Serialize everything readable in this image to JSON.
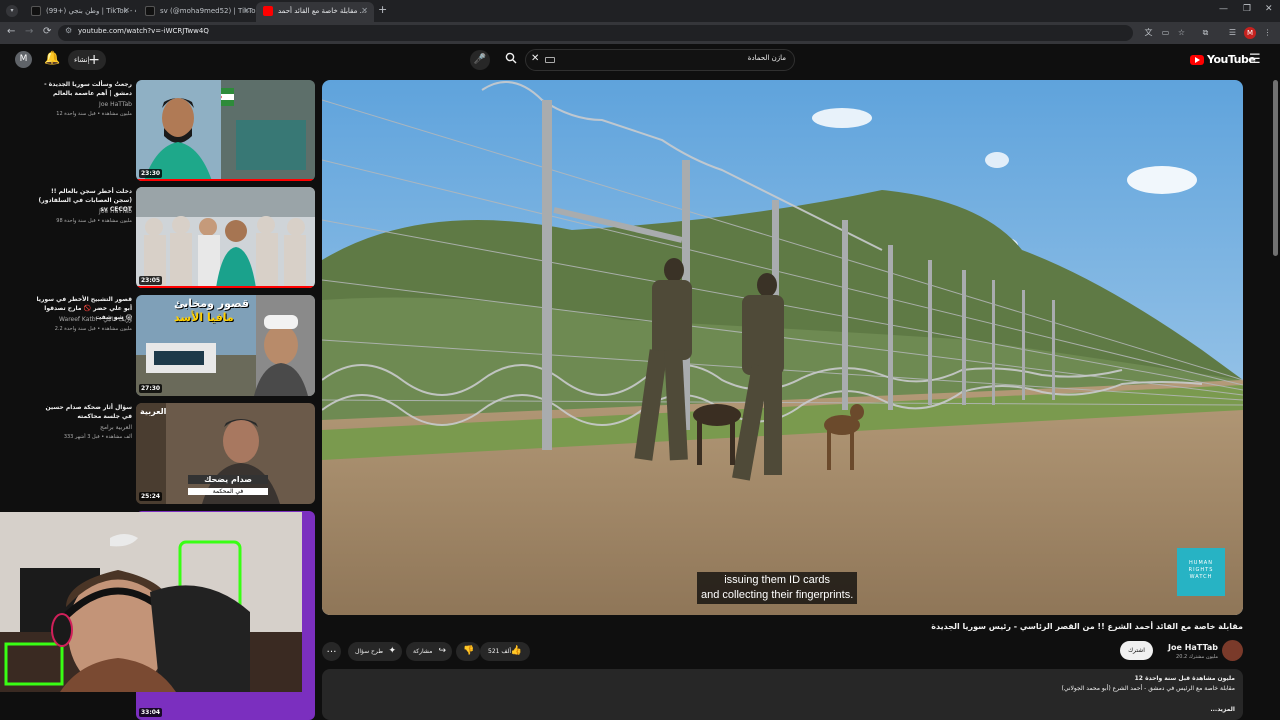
{
  "browser": {
    "tabs": [
      {
        "label": "(99+) وطن بنجي | TikTok - 476",
        "favicon_color": "#111111"
      },
      {
        "label": "sv (@moha9med52) | TikTok",
        "favicon_color": "#111111"
      },
      {
        "label": "مقابلة خاصة مع القائد أحمد ...",
        "favicon_color": "#ff0000"
      }
    ],
    "new_tab": "+",
    "tab_menu": "▾",
    "url": "youtube.com/watch?v=-iWCRJTww4Q",
    "profile_initial": "M",
    "window_controls": [
      "—",
      "❐",
      "✕"
    ]
  },
  "youtube": {
    "header": {
      "user_initial": "M",
      "create_label": "إنشاء",
      "search_value": "مازن الحمادة",
      "logo_text": "YouTube"
    },
    "recommendations": [
      {
        "title": "رجعتُ وسألت سوريا الجديدة - دمشق | أهم عاصمة بالعالم",
        "channel": "Joe HaTTab",
        "meta": "12 مليون مشاهدة • قبل سنة واحدة",
        "duration": "23:30",
        "progress": 1.0
      },
      {
        "title": "دخلت أخطر سجن بالعالم !! (سجن العصابات في السلفادور) sv CECOT",
        "channel": "Joe HaTTab",
        "meta": "98 مليون مشاهدة • قبل سنة واحدة",
        "duration": "23:05",
        "progress": 1.0
      },
      {
        "title": "قصور التشبيح الأخطر في سوريا أبو علي خضر 🚫 مارح تصدقوا شو شفت 😱",
        "channel": "Wareef Katbi - وريف كاتبي",
        "meta": "2.2 مليون مشاهدة • قبل سنة واحدة",
        "duration": "27:30",
        "progress": 0
      },
      {
        "title": "سؤال أثار ضحكة صدام حسين في جلسة محاكمته",
        "channel": "العربية برامج",
        "meta": "333 ألف مشاهدة • قبل 3 أشهر",
        "duration": "25:24",
        "progress": 0
      },
      {
        "title": "",
        "channel": "",
        "meta": "",
        "duration": "33:04",
        "progress": 0
      }
    ],
    "thumb_texts": {
      "t3_title": "قصور ومخابئ",
      "t3_sub": "مافيا الأسد",
      "t4_logo": "العربية",
      "t4_cap1": "صدام يضحك",
      "t4_cap2": "في المحكمة"
    },
    "video": {
      "caption_line1": "issuing them ID cards",
      "caption_line2": "and collecting their fingerprints.",
      "watermark": "HUMAN RIGHTS WATCH",
      "title": "مقابلة خاصة مع القائد أحمد الشرع !! من القصر الرئاسي - رئيس سوريا الجديدة",
      "channel": "Joe HaTTab",
      "subscribers": "20.2 مليون مشترك",
      "subscribe_label": "اشترك",
      "likes": "521 ألف",
      "share_label": "مشاركة",
      "ask_label": "طرح سؤال",
      "more": "…",
      "desc_stats": "12 مليون مشاهدة  قبل سنة واحدة",
      "desc_text": "مقابلة خاصة مع الرئيس في دمشق - أحمد الشرع (أبو محمد الجولاني)",
      "desc_more": "...المزيد"
    }
  }
}
